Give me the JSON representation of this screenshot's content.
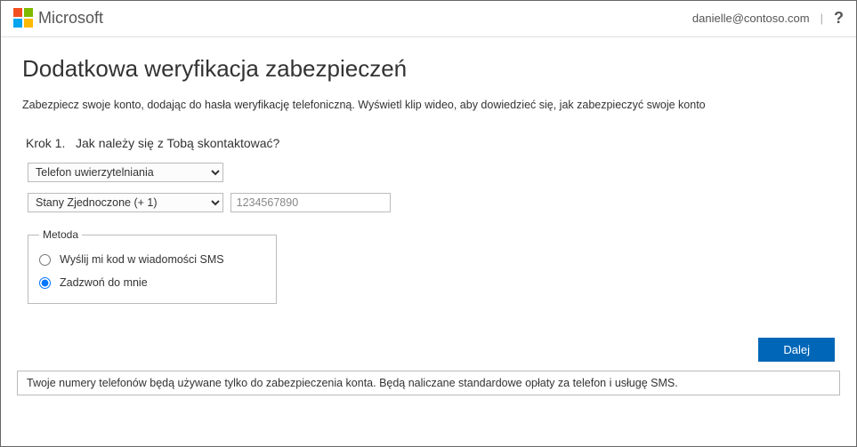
{
  "header": {
    "brand": "Microsoft",
    "user_email": "danielle@contoso.com",
    "help_label": "?"
  },
  "page": {
    "title": "Dodatkowa weryfikacja zabezpieczeń",
    "description": "Zabezpiecz swoje konto, dodając do hasła weryfikację telefoniczną. Wyświetl klip wideo, aby dowiedzieć się, jak zabezpieczyć swoje konto",
    "step_label": "Krok 1.   Jak należy się z Tobą skontaktować?"
  },
  "form": {
    "contact_method_selected": "Telefon uwierzytelniania",
    "country_selected": "Stany Zjednoczone (+ 1)",
    "phone_placeholder": "1234567890",
    "method_legend": "Metoda",
    "radio_sms_label": "Wyślij mi kod w wiadomości SMS",
    "radio_call_label": "Zadzwoń do mnie",
    "next_button": "Dalej"
  },
  "notice": "Twoje numery telefonów będą używane tylko do zabezpieczenia konta. Będą naliczane standardowe opłaty za telefon i usługę SMS."
}
